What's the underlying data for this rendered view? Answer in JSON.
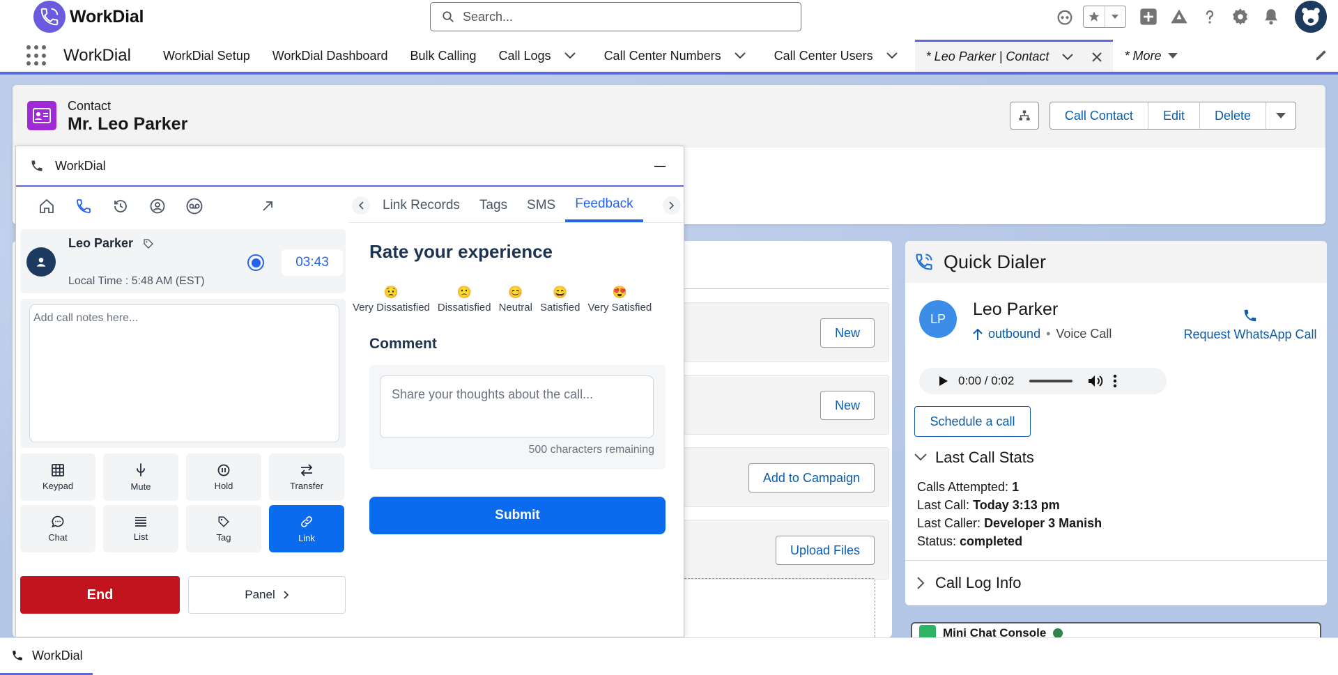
{
  "global_header": {
    "logo_text": "WorkDial",
    "search_placeholder": "Search..."
  },
  "nav": {
    "app_name": "WorkDial",
    "items": [
      {
        "label": "WorkDial Setup"
      },
      {
        "label": "WorkDial Dashboard"
      },
      {
        "label": "Bulk Calling"
      },
      {
        "label": "Call Logs"
      },
      {
        "label": "Call Center Numbers"
      },
      {
        "label": "Call Center Users"
      }
    ],
    "active_tab": "* Leo Parker | Contact",
    "more": "* More"
  },
  "record": {
    "type": "Contact",
    "name": "Mr. Leo Parker",
    "actions": [
      "Call Contact",
      "Edit",
      "Delete"
    ]
  },
  "related": {
    "buttons": [
      "New",
      "New",
      "Add to Campaign",
      "Upload Files"
    ]
  },
  "widget": {
    "title": "WorkDial",
    "caller": {
      "name": "Leo Parker",
      "local_time": "Local Time : 5:48 AM (EST)",
      "timer": "03:43"
    },
    "notes_placeholder": "Add call notes here...",
    "controls": [
      "Keypad",
      "Mute",
      "Hold",
      "Transfer",
      "Chat",
      "List",
      "Tag",
      "Link"
    ],
    "active_control": "Link",
    "end_label": "End",
    "panel_label": "Panel",
    "tabs": [
      "Link Records",
      "Tags",
      "SMS",
      "Feedback"
    ],
    "active_tab": "Feedback",
    "feedback": {
      "title": "Rate your experience",
      "ratings": [
        {
          "emoji": "😟",
          "label": "Very Dissatisfied"
        },
        {
          "emoji": "🙁",
          "label": "Dissatisfied"
        },
        {
          "emoji": "😊",
          "label": "Neutral"
        },
        {
          "emoji": "😄",
          "label": "Satisfied"
        },
        {
          "emoji": "😍",
          "label": "Very Satisfied"
        }
      ],
      "comment_label": "Comment",
      "comment_placeholder": "Share your thoughts about the call...",
      "chars_remaining": "500 characters remaining",
      "submit_label": "Submit"
    }
  },
  "quick_dialer": {
    "title": "Quick Dialer",
    "initials": "LP",
    "name": "Leo Parker",
    "direction": "outbound",
    "separator": "•",
    "call_type": "Voice Call",
    "whatsapp_label": "Request WhatsApp Call",
    "audio_time": "0:00 / 0:02",
    "schedule_label": "Schedule a call",
    "last_call_stats_label": "Last Call Stats",
    "stats": [
      {
        "label": "Calls Attempted:",
        "value": "1"
      },
      {
        "label": "Last Call:",
        "value": "Today 3:13 pm"
      },
      {
        "label": "Last Caller:",
        "value": "Developer 3 Manish"
      },
      {
        "label": "Status:",
        "value": "completed"
      }
    ],
    "call_log_info_label": "Call Log Info"
  },
  "mini_chat": {
    "label": "Mini Chat Console"
  },
  "utility_bar": {
    "label": "WorkDial"
  },
  "colors": {
    "brand": "#5b6ad6",
    "primary_blue": "#0b6bee",
    "end_red": "#c2141e",
    "link_blue": "#0b5cab"
  }
}
